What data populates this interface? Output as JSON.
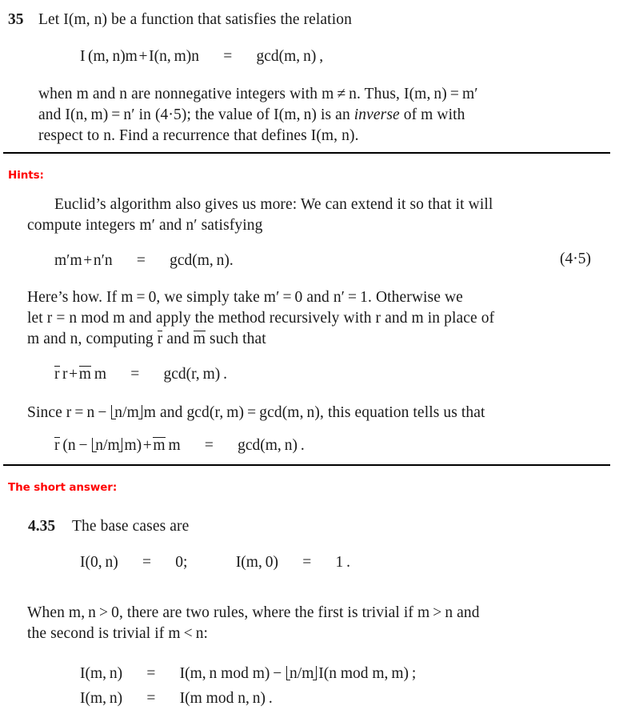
{
  "document": {
    "kind": "textbook-exercise-page",
    "accent_color": "#ff0000",
    "text_color": "#1a1a1a",
    "background_color": "#ffffff"
  },
  "exercise": {
    "number": "35",
    "intro": "Let I(m, n) be a function that satisfies the relation",
    "display_equation": "I(m, n)m + I(n, m)n  =  gcd(m, n) ,",
    "body_line_1": "when m and n are nonnegative integers with m ≠ n. Thus, I(m, n) = m′",
    "body_line_2": "and I(n, m) = n′ in (4.5); the value of I(m, n) is an inverse of m with",
    "body_line_3": "respect to n. Find a recurrence that defines I(m, n)."
  },
  "hints": {
    "label": "Hints:",
    "paragraph_1_line_1": "Euclid’s algorithm also gives us more: We can extend it so that it will",
    "paragraph_1_line_2": "compute integers m′ and n′ satisfying",
    "equation_4_5": "m′m + n′n  =  gcd(m, n).",
    "equation_4_5_number": "(4.5)",
    "paragraph_2_line_1": "Here’s how. If m = 0, we simply take m′ = 0 and n′ = 1. Otherwise we",
    "paragraph_2_line_2": "let r = n mod m and apply the method recursively with r and m in place of",
    "paragraph_2_line_3": "m and n, computing r̄ and m̄ such that",
    "equation_rbar": "r̄ r + m̄ m  =  gcd(r, m).",
    "paragraph_3": "Since r = n − ⌊n/m⌋m and gcd(r, m) = gcd(m, n), this equation tells us that",
    "equation_final": "r̄ (n − ⌊n/m⌋m) + m̄ m  =  gcd(m, n)."
  },
  "answer": {
    "label": "The short answer:",
    "number": "4.35",
    "intro": "The base cases are",
    "base_cases": "I(0, n)  =  0;     I(m, 0)  =  1 .",
    "condition_line_1": "When m, n > 0, there are two rules, where the first is trivial if m > n and",
    "condition_line_2": "the second is trivial if m < n:",
    "rule_1": "I(m, n)  =  I(m, n mod m) − ⌊n/m⌋I(n mod m, m) ;",
    "rule_2": "I(m, n)  =  I(m mod n, n) ."
  }
}
